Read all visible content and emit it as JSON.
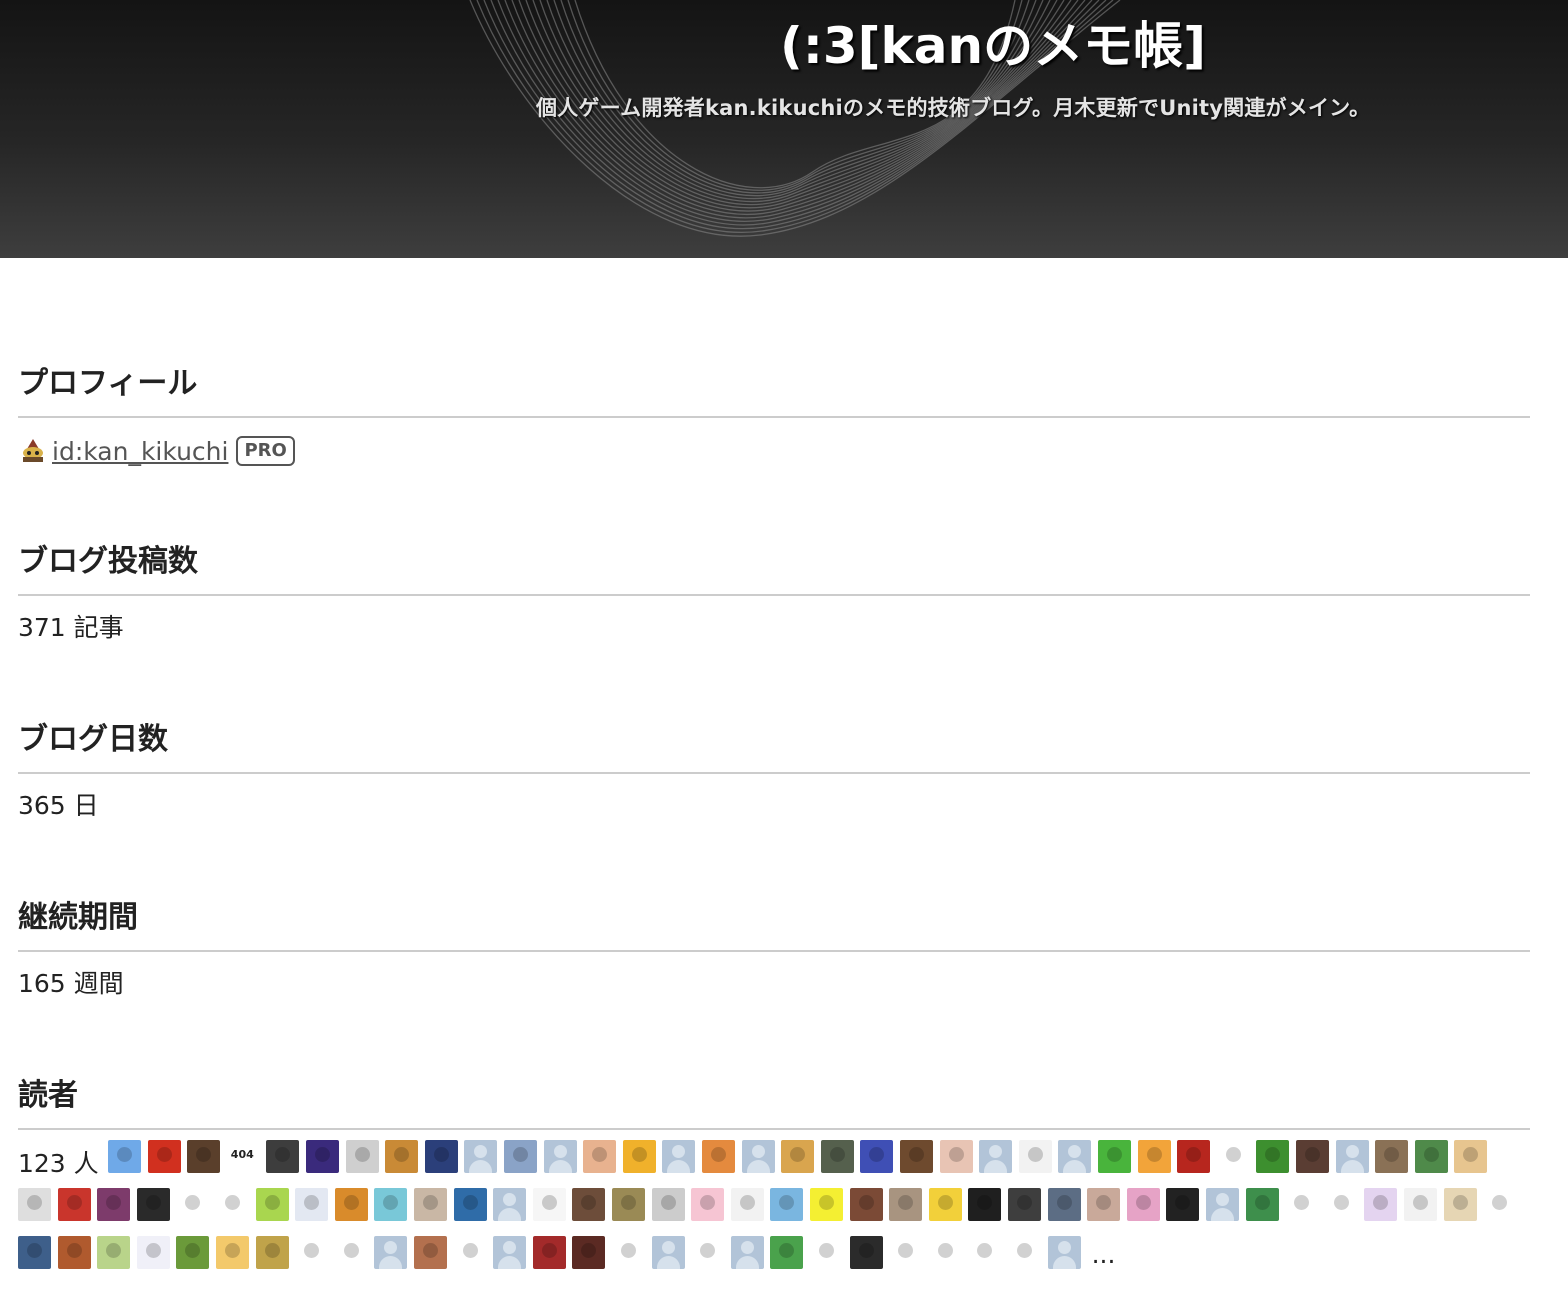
{
  "header": {
    "title": "(:3[kanのメモ帳]",
    "description": "個人ゲーム開発者kan.kikuchiのメモ的技術ブログ。月木更新でUnity関連がメイン。"
  },
  "profile": {
    "heading": "プロフィール",
    "user_id": "id:kan_kikuchi",
    "badge": "PRO",
    "icon": "user-avatar-icon"
  },
  "posts": {
    "heading": "ブログ投稿数",
    "value": "371 記事"
  },
  "days": {
    "heading": "ブログ日数",
    "value": "365 日"
  },
  "duration": {
    "heading": "継続期間",
    "value": "165 週間"
  },
  "readers": {
    "heading": "読者",
    "count": "123 人",
    "more": "...",
    "avatars": [
      {
        "kind": "image",
        "color": "#6fa9e8"
      },
      {
        "kind": "image",
        "color": "#d1301f"
      },
      {
        "kind": "image",
        "color": "#5a3f2b"
      },
      {
        "kind": "image",
        "color": "#ffffff",
        "text": "404"
      },
      {
        "kind": "image",
        "color": "#3d3d3d"
      },
      {
        "kind": "image",
        "color": "#3a2a7c"
      },
      {
        "kind": "image",
        "color": "#cfcfcf"
      },
      {
        "kind": "image",
        "color": "#c98a36"
      },
      {
        "kind": "image",
        "color": "#2b3f7a"
      },
      {
        "kind": "default"
      },
      {
        "kind": "image",
        "color": "#8aa3c7"
      },
      {
        "kind": "default"
      },
      {
        "kind": "image",
        "color": "#e8b28f"
      },
      {
        "kind": "image",
        "color": "#f0b12b"
      },
      {
        "kind": "default"
      },
      {
        "kind": "image",
        "color": "#e48a3e"
      },
      {
        "kind": "default"
      },
      {
        "kind": "image",
        "color": "#d9a54e"
      },
      {
        "kind": "image",
        "color": "#55604d"
      },
      {
        "kind": "image",
        "color": "#3f4fb5"
      },
      {
        "kind": "image",
        "color": "#6e4a2e"
      },
      {
        "kind": "image",
        "color": "#e8c4b4"
      },
      {
        "kind": "default"
      },
      {
        "kind": "image",
        "color": "#f2f2f2"
      },
      {
        "kind": "default"
      },
      {
        "kind": "image",
        "color": "#49b43c"
      },
      {
        "kind": "image",
        "color": "#f2a43a"
      },
      {
        "kind": "image",
        "color": "#b7261e"
      },
      {
        "kind": "image",
        "color": "#ffffff"
      },
      {
        "kind": "image",
        "color": "#3d8f2f"
      },
      {
        "kind": "image",
        "color": "#5a3d33"
      },
      {
        "kind": "default"
      },
      {
        "kind": "image",
        "color": "#8a7156"
      },
      {
        "kind": "image",
        "color": "#4f8a4a"
      },
      {
        "kind": "image",
        "color": "#e7c58f"
      },
      {
        "kind": "image",
        "color": "#dedede"
      },
      {
        "kind": "image",
        "color": "#c9352c"
      },
      {
        "kind": "image",
        "color": "#7d3b6b"
      },
      {
        "kind": "image",
        "color": "#2a2a2a"
      },
      {
        "kind": "image",
        "color": "#ffffff"
      },
      {
        "kind": "image",
        "color": "#ffffff"
      },
      {
        "kind": "image",
        "color": "#a9d64f"
      },
      {
        "kind": "image",
        "color": "#e3e8f2"
      },
      {
        "kind": "image",
        "color": "#d98b2b"
      },
      {
        "kind": "image",
        "color": "#79c8d8"
      },
      {
        "kind": "image",
        "color": "#c9b7a5"
      },
      {
        "kind": "image",
        "color": "#2f6ca8"
      },
      {
        "kind": "default"
      },
      {
        "kind": "image",
        "color": "#f6f6f6"
      },
      {
        "kind": "image",
        "color": "#6d4d3a"
      },
      {
        "kind": "image",
        "color": "#9a8a55"
      },
      {
        "kind": "image",
        "color": "#cccccc"
      },
      {
        "kind": "image",
        "color": "#f6c5d3"
      },
      {
        "kind": "image",
        "color": "#f2f2f2"
      },
      {
        "kind": "image",
        "color": "#7ab6e0"
      },
      {
        "kind": "image",
        "color": "#f4ef32"
      },
      {
        "kind": "image",
        "color": "#7b4a36"
      },
      {
        "kind": "image",
        "color": "#a89480"
      },
      {
        "kind": "image",
        "color": "#f2d03a"
      },
      {
        "kind": "image",
        "color": "#1f1f1f"
      },
      {
        "kind": "image",
        "color": "#3e3e3e"
      },
      {
        "kind": "image",
        "color": "#5c6d84"
      },
      {
        "kind": "image",
        "color": "#c9a99a"
      },
      {
        "kind": "image",
        "color": "#e6a3c6"
      },
      {
        "kind": "image",
        "color": "#222222"
      },
      {
        "kind": "default"
      },
      {
        "kind": "image",
        "color": "#3e8f4c"
      },
      {
        "kind": "image",
        "color": "#ffffff"
      },
      {
        "kind": "image",
        "color": "#ffffff"
      },
      {
        "kind": "image",
        "color": "#e4d4f0"
      },
      {
        "kind": "image",
        "color": "#f2f2f2"
      },
      {
        "kind": "image",
        "color": "#e6d6b4"
      },
      {
        "kind": "image",
        "color": "#ffffff"
      },
      {
        "kind": "image",
        "color": "#3e5f8a"
      },
      {
        "kind": "image",
        "color": "#b05a2e"
      },
      {
        "kind": "image",
        "color": "#b9d48a"
      },
      {
        "kind": "image",
        "color": "#f0f0f8"
      },
      {
        "kind": "image",
        "color": "#6b9a3a"
      },
      {
        "kind": "image",
        "color": "#f3c96b"
      },
      {
        "kind": "image",
        "color": "#c0a34a"
      },
      {
        "kind": "image",
        "color": "#ffffff"
      },
      {
        "kind": "image",
        "color": "#ffffff"
      },
      {
        "kind": "default"
      },
      {
        "kind": "image",
        "color": "#b3704e"
      },
      {
        "kind": "image",
        "color": "#ffffff"
      },
      {
        "kind": "default"
      },
      {
        "kind": "image",
        "color": "#a32a2a"
      },
      {
        "kind": "image",
        "color": "#5b2a23"
      },
      {
        "kind": "image",
        "color": "#ffffff"
      },
      {
        "kind": "default"
      },
      {
        "kind": "image",
        "color": "#ffffff"
      },
      {
        "kind": "default"
      },
      {
        "kind": "image",
        "color": "#4aa24c"
      },
      {
        "kind": "image",
        "color": "#ffffff"
      },
      {
        "kind": "image",
        "color": "#2b2b2b"
      },
      {
        "kind": "image",
        "color": "#ffffff"
      },
      {
        "kind": "image",
        "color": "#ffffff"
      },
      {
        "kind": "image",
        "color": "#ffffff"
      },
      {
        "kind": "image",
        "color": "#ffffff"
      },
      {
        "kind": "default"
      }
    ]
  }
}
